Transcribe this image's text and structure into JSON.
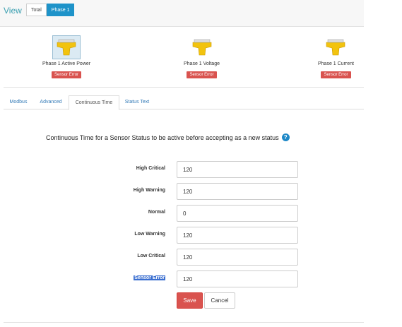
{
  "view": {
    "label": "View",
    "tabs": [
      {
        "label": "Total",
        "active": false
      },
      {
        "label": "Phase 1",
        "active": true
      }
    ]
  },
  "sensors": [
    {
      "name": "Phase 1 Active Power",
      "status": "Sensor Error",
      "selected": true,
      "icon": "sensor-device-icon"
    },
    {
      "name": "Phase 1 Voltage",
      "status": "Sensor Error",
      "selected": false,
      "icon": "sensor-device-icon"
    },
    {
      "name": "Phase 1 Current",
      "status": "Sensor Error",
      "selected": false,
      "icon": "sensor-device-icon"
    }
  ],
  "tabs": [
    {
      "label": "Modbus",
      "active": false
    },
    {
      "label": "Advanced",
      "active": false
    },
    {
      "label": "Continuous Time",
      "active": true
    },
    {
      "label": "Status Text",
      "active": false
    }
  ],
  "form": {
    "heading": "Continuous Time for a Sensor Status to be active before accepting as a new status",
    "help_icon": "?",
    "rows": [
      {
        "label": "High Critical",
        "value": "120"
      },
      {
        "label": "High Warning",
        "value": "120"
      },
      {
        "label": "Normal",
        "value": "0"
      },
      {
        "label": "Low Warning",
        "value": "120"
      },
      {
        "label": "Low Critical",
        "value": "120"
      },
      {
        "label": "Sensor Error",
        "value": "120",
        "highlighted": true
      }
    ],
    "save_label": "Save",
    "cancel_label": "Cancel"
  },
  "colors": {
    "accent": "#1e93c9",
    "error": "#d9534f",
    "view_label": "#3a9fb0",
    "sensor_icon": "#f2c30f"
  }
}
